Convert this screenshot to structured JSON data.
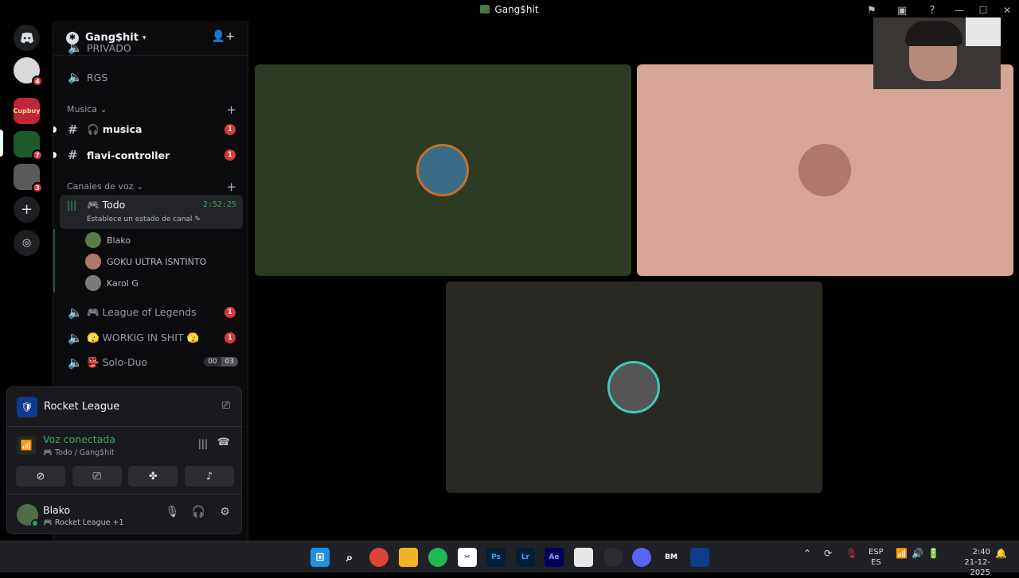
{
  "window": {
    "title": "Gang$hit"
  },
  "guilds": [
    {
      "name": "server-1",
      "badge": "4",
      "color": "#d9d9d9"
    },
    {
      "name": "server-2",
      "badge": "",
      "color": "#c2253b",
      "label": "Cupbuy"
    },
    {
      "name": "server-3",
      "badge": "7",
      "color": "#1d5a2a"
    },
    {
      "name": "server-4",
      "badge": "3",
      "color": "#5a5a5a"
    }
  ],
  "sidebar": {
    "server_name": "Gang$hit",
    "partial_channel": "PRIVADO",
    "rgs": "RGS",
    "cat_musica": "Musica",
    "channels_text": [
      {
        "icon": "#",
        "label": "🎧 musica",
        "badge": "1"
      },
      {
        "icon": "#",
        "label": "flavi-controller",
        "badge": "1"
      }
    ],
    "cat_voice": "Canales de voz",
    "active_voice": {
      "label": "🎮 Todo",
      "time": "2:52:25",
      "status": "Establece un estado de canal"
    },
    "voice_users": [
      {
        "name": "Blako",
        "color": "#5a7a4a"
      },
      {
        "name": "GOKU ULTRA ISNTINTO",
        "color": "#b0786a"
      },
      {
        "name": "Karol G",
        "color": "#7a7a7a"
      }
    ],
    "voice_channels": [
      {
        "label": "🎮 League of Legends",
        "badge": "1"
      },
      {
        "label": "🫣 WORKIG IN SHIT 🫣",
        "badge": "1"
      },
      {
        "label": "👺 Solo-Duo",
        "count_a": "00",
        "count_b": "03"
      }
    ]
  },
  "panel": {
    "game": "Rocket League",
    "voice_title": "Voz conectada",
    "voice_sub": "🎮 Todo / Gang$hit",
    "user_name": "Blako",
    "user_activity": "🎮 Rocket League +1"
  },
  "tiles": [
    {
      "bg": "#2c3b21"
    },
    {
      "bg": "#d6a595"
    },
    {
      "bg": "#2a2822"
    }
  ],
  "taskbar": {
    "lang_top": "ESP",
    "lang_bottom": "ES",
    "time": "2:40",
    "date": "21-12-2025",
    "apps": [
      "Ps",
      "Lr",
      "Ae",
      "BM"
    ]
  }
}
